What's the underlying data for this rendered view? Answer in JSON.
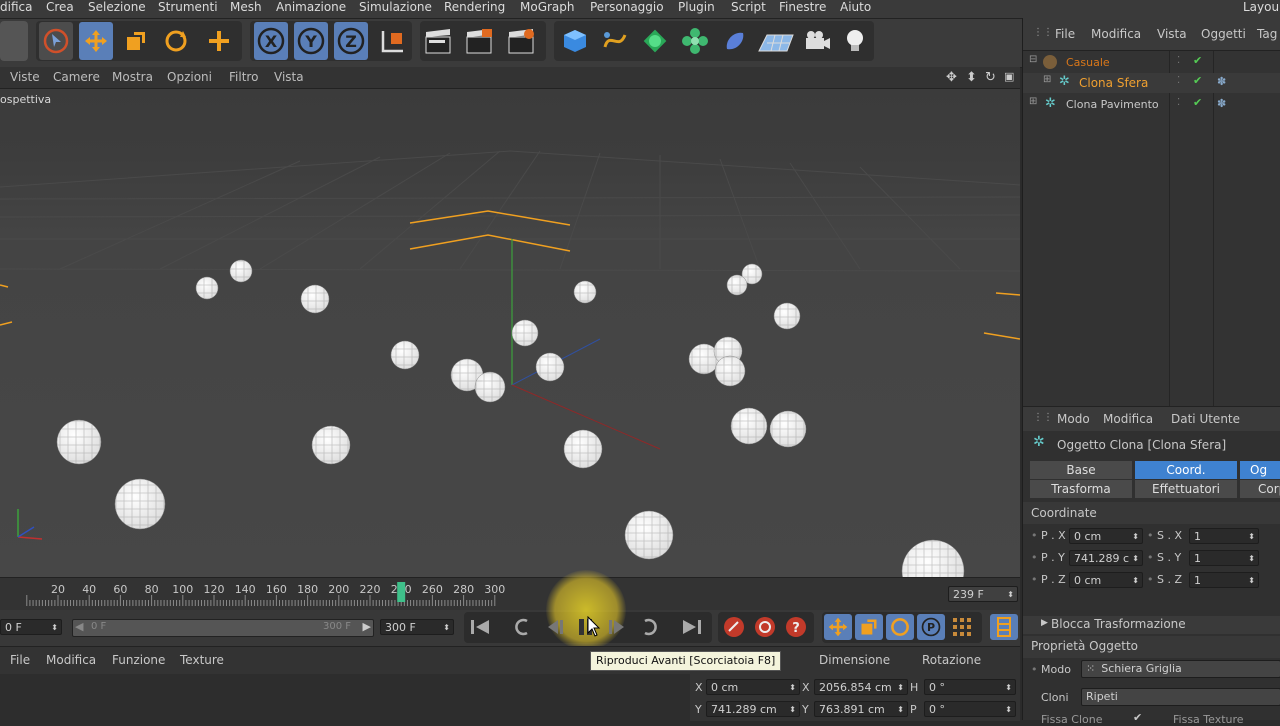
{
  "menubar": {
    "items": [
      "difica",
      "Crea",
      "Selezione",
      "Strumenti",
      "Mesh",
      "Animazione",
      "Simulazione",
      "Rendering",
      "MoGraph",
      "Personaggio",
      "Plugin",
      "Script",
      "Finestre",
      "Aiuto"
    ],
    "layout_label": "Layou"
  },
  "toolbar": {
    "icons": [
      "undo-icon",
      "select-arrow-icon",
      "move-icon",
      "scale-icon",
      "rotate-icon",
      "add-icon",
      "x-axis-icon",
      "y-axis-icon",
      "z-axis-icon",
      "coordinate-system-icon",
      "render-view-icon",
      "render-picture-queue-icon",
      "render-settings-icon",
      "cube-icon",
      "spline-icon",
      "nurbs-icon",
      "mograph-cloner-icon",
      "deformer-icon",
      "floor-icon",
      "camera-icon",
      "light-icon"
    ],
    "axis_labels": [
      "X",
      "Y",
      "Z"
    ]
  },
  "viewport": {
    "menu": [
      "Viste",
      "Camere",
      "Mostra",
      "Opzioni",
      "Filtro",
      "Vista"
    ],
    "label": "ospettiva"
  },
  "timeline": {
    "ticks": [
      "20",
      "40",
      "60",
      "80",
      "100",
      "120",
      "140",
      "160",
      "180",
      "200",
      "220",
      "240",
      "260",
      "280",
      "300"
    ],
    "current_frame": 240,
    "frame_field": "239 F"
  },
  "transport": {
    "start_field": "0 F",
    "slider_left": "0 F",
    "slider_right": "300 F",
    "end_field": "300 F",
    "tooltip": "Riproduci Avanti [Scorciatoia F8]"
  },
  "material_bar": {
    "menu": [
      "File",
      "Modifica",
      "Funzione",
      "Texture"
    ]
  },
  "coord_panel": {
    "headers": [
      "Dimensione",
      "Rotazione"
    ],
    "rows": [
      {
        "axis": "X",
        "pos": "0 cm",
        "dim_axis": "X",
        "dim": "2056.854 cm",
        "rot_axis": "H",
        "rot": "0 °"
      },
      {
        "axis": "Y",
        "pos": "741.289 cm",
        "dim_axis": "Y",
        "dim": "763.891 cm",
        "rot_axis": "P",
        "rot": "0 °"
      }
    ]
  },
  "object_manager": {
    "menu": [
      "File",
      "Modifica",
      "Vista",
      "Oggetti",
      "Tag"
    ],
    "objects": [
      {
        "name": "Casuale",
        "color": "#d9771a"
      },
      {
        "name": "Clona Sfera",
        "color": "#f0a030"
      },
      {
        "name": "Clona Pavimento",
        "color": "#c8c8c8"
      }
    ]
  },
  "attribute_manager": {
    "menu": [
      "Modo",
      "Modifica",
      "Dati Utente"
    ],
    "title": "Oggetto Clona [Clona Sfera]",
    "tabs_row1": [
      "Base",
      "Coord.",
      "Og"
    ],
    "tabs_row2": [
      "Trasforma",
      "Effettuatori",
      "Corpo"
    ],
    "section": "Coordinate",
    "coords": [
      {
        "p_label": "P . X",
        "p_val": "0 cm",
        "s_label": "S . X",
        "s_val": "1"
      },
      {
        "p_label": "P . Y",
        "p_val": "741.289 c",
        "s_label": "S . Y",
        "s_val": "1"
      },
      {
        "p_label": "P . Z",
        "p_val": "0 cm",
        "s_label": "S . Z",
        "s_val": "1"
      }
    ],
    "lock_transform": "Blocca Trasformazione",
    "properties_title": "Proprietà Oggetto",
    "mode_label": "Modo",
    "mode_value": "Schiera Griglia",
    "clones_label": "Cloni",
    "clones_value": "Ripeti",
    "cut_labels": [
      "Fissa Clone",
      "Fissa Texture"
    ]
  },
  "colors": {
    "accent_blue": "#3a78c4",
    "orange": "#f0a030",
    "selection_red": "#c23a2a"
  }
}
